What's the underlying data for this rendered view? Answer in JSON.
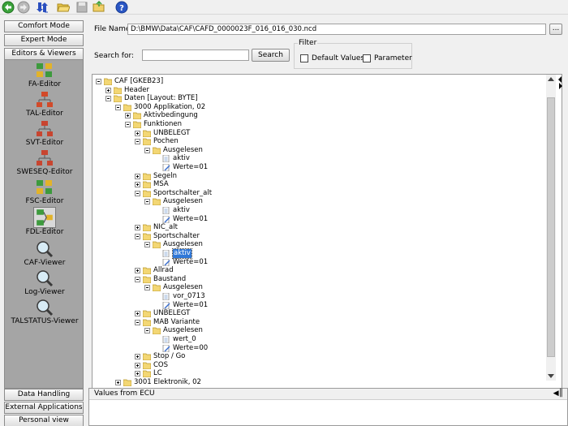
{
  "toolbar": {
    "icons": [
      "back-icon",
      "forward-icon",
      "transfer-icon",
      "folder-open-icon",
      "save-icon",
      "folder-icon",
      "help-icon"
    ]
  },
  "sidebar": {
    "comfort_mode": "Comfort Mode",
    "expert_mode": "Expert Mode",
    "editors_viewers": "Editors & Viewers",
    "data_handling": "Data Handling",
    "external_applications": "External Applications",
    "personal_view": "Personal view",
    "tools": [
      {
        "label": "FA-Editor",
        "icon": "fa-editor-icon"
      },
      {
        "label": "TAL-Editor",
        "icon": "tal-editor-icon"
      },
      {
        "label": "SVT-Editor",
        "icon": "svt-editor-icon"
      },
      {
        "label": "SWESEQ-Editor",
        "icon": "sweseq-editor-icon"
      },
      {
        "label": "FSC-Editor",
        "icon": "fsc-editor-icon"
      },
      {
        "label": "FDL-Editor",
        "icon": "fdl-editor-icon",
        "selected": true
      },
      {
        "label": "CAF-Viewer",
        "icon": "caf-viewer-icon"
      },
      {
        "label": "Log-Viewer",
        "icon": "log-viewer-icon"
      },
      {
        "label": "TALSTATUS-Viewer",
        "icon": "talstatus-viewer-icon"
      }
    ]
  },
  "file": {
    "label": "File Name:",
    "value": "D:\\BMW\\Data\\CAF\\CAFD_0000023F_016_016_030.ncd",
    "browse": "..."
  },
  "search": {
    "label": "Search for:",
    "value": "",
    "button": "Search"
  },
  "filter": {
    "title": "Filter",
    "default_values": "Default Values",
    "default_values_checked": false,
    "parameter": "Parameter",
    "parameter_checked": false
  },
  "tree": [
    {
      "text": "CAF [GKEB23]",
      "kind": "folder",
      "exp": "minus"
    },
    {
      "text": "Header",
      "kind": "folder",
      "exp": "plus"
    },
    {
      "text": "Daten [Layout: BYTE]",
      "kind": "folder",
      "exp": "minus"
    },
    {
      "text": "3000 Applikation, 02",
      "kind": "folder",
      "exp": "minus"
    },
    {
      "text": "Aktivbedingung",
      "kind": "folder",
      "exp": "plus"
    },
    {
      "text": "Funktionen",
      "kind": "folder",
      "exp": "minus"
    },
    {
      "text": "UNBELEGT",
      "kind": "folder",
      "exp": "plus"
    },
    {
      "text": "Pochen",
      "kind": "folder",
      "exp": "minus"
    },
    {
      "text": "Ausgelesen",
      "kind": "folder",
      "exp": "minus"
    },
    {
      "text": "aktiv",
      "kind": "file"
    },
    {
      "text": "Werte=01",
      "kind": "edit"
    },
    {
      "text": "Segeln",
      "kind": "folder",
      "exp": "plus"
    },
    {
      "text": "MSA",
      "kind": "folder",
      "exp": "plus"
    },
    {
      "text": "Sportschalter_alt",
      "kind": "folder",
      "exp": "minus"
    },
    {
      "text": "Ausgelesen",
      "kind": "folder",
      "exp": "minus"
    },
    {
      "text": "aktiv",
      "kind": "file"
    },
    {
      "text": "Werte=01",
      "kind": "edit"
    },
    {
      "text": "NIC_alt",
      "kind": "folder",
      "exp": "plus"
    },
    {
      "text": "Sportschalter",
      "kind": "folder",
      "exp": "minus"
    },
    {
      "text": "Ausgelesen",
      "kind": "folder",
      "exp": "minus"
    },
    {
      "text": "aktiv",
      "kind": "file",
      "selected": true
    },
    {
      "text": "Werte=01",
      "kind": "edit"
    },
    {
      "text": "Allrad",
      "kind": "folder",
      "exp": "plus"
    },
    {
      "text": "Baustand",
      "kind": "folder",
      "exp": "minus"
    },
    {
      "text": "Ausgelesen",
      "kind": "folder",
      "exp": "minus"
    },
    {
      "text": "vor_0713",
      "kind": "file"
    },
    {
      "text": "Werte=01",
      "kind": "edit"
    },
    {
      "text": "UNBELEGT",
      "kind": "folder",
      "exp": "plus"
    },
    {
      "text": "MAB Variante",
      "kind": "folder",
      "exp": "minus"
    },
    {
      "text": "Ausgelesen",
      "kind": "folder",
      "exp": "minus"
    },
    {
      "text": "wert_0",
      "kind": "file"
    },
    {
      "text": "Werte=00",
      "kind": "edit"
    },
    {
      "text": "Stop / Go",
      "kind": "folder",
      "exp": "plus"
    },
    {
      "text": "COS",
      "kind": "folder",
      "exp": "plus"
    },
    {
      "text": "LC",
      "kind": "folder",
      "exp": "plus"
    },
    {
      "text": "3001 Elektronik, 02",
      "kind": "folder",
      "exp": "plus"
    }
  ],
  "bottom_panel": {
    "title": "Values from ECU"
  },
  "colors": {
    "tools_panel": "#a5a5a5",
    "selection": "#3078d8",
    "folder": "#f3d774"
  }
}
